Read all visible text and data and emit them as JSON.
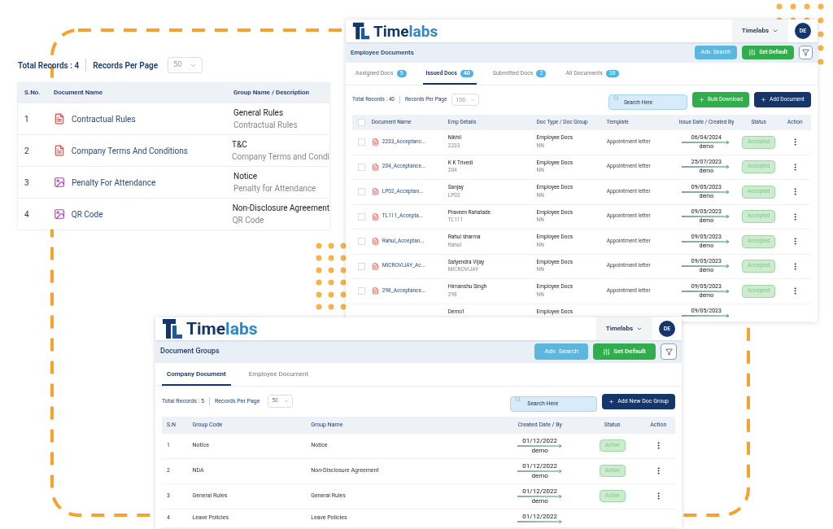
{
  "document_list": {
    "total_records": "Total Records : 4",
    "records_per_page_label": "Records Per Page",
    "records_per_page": "50",
    "columns": [
      "S.No.",
      "Document Name",
      "Group Name / Description"
    ],
    "rows": [
      {
        "sno": "1",
        "kind": "pdf",
        "name": "Contractual Rules",
        "group": "General Rules",
        "description": "Contractual Rules"
      },
      {
        "sno": "2",
        "kind": "pdf",
        "name": "Company Terms And Conditions",
        "group": "T&C",
        "description": "Company Terms and Condi"
      },
      {
        "sno": "3",
        "kind": "image",
        "name": "Penalty For Attendance",
        "group": "Notice",
        "description": "Penalty for Attendance"
      },
      {
        "sno": "4",
        "kind": "image",
        "name": "QR Code",
        "group": "Non-Disclosure Agreement",
        "description": "QR Code"
      }
    ]
  },
  "employee_documents": {
    "logo": {
      "part_1": "Time",
      "part_2": "labs"
    },
    "company": "Timelabs",
    "avatar": "DE",
    "title": "Employee Documents",
    "adv_search": "Adv. Search",
    "set_default": "Set Default",
    "tabs": [
      {
        "label": "Assigned Docs",
        "count": "5",
        "selected": false
      },
      {
        "label": "Issued Docs",
        "count": "40",
        "selected": true
      },
      {
        "label": "Submitted Docs",
        "count": "2",
        "selected": false
      },
      {
        "label": "All Documents",
        "count": "38",
        "selected": false
      }
    ],
    "total_records": "Total Records : 40",
    "records_per_page_label": "Records Per Page",
    "records_per_page": "100",
    "search_placeholder": "Search Here",
    "bulk_download": "Bulk Download",
    "add_document": "Add Document",
    "select_all_checked": false,
    "columns": [
      "Document Name",
      "Emp Details",
      "Doc Type / Doc Group",
      "Template",
      "Issue Date / Created By",
      "Status",
      "Action"
    ],
    "rows": [
      {
        "checked": false,
        "document": "2233_Acceptanc...",
        "emp_name": "Nikhil",
        "emp_code": "2233",
        "doc_type": "Employee Docs",
        "doc_group": "NN",
        "template": "Appointment letter",
        "date": "06/04/2024",
        "created_by": "demo",
        "status": "Accepted"
      },
      {
        "checked": false,
        "document": "204_Acceptance...",
        "emp_name": "K K Trivedi",
        "emp_code": "204",
        "doc_type": "Employee Docs",
        "doc_group": "NN",
        "template": "Appointment letter",
        "date": "25/07/2023",
        "created_by": "demo",
        "status": "Accepted"
      },
      {
        "checked": false,
        "document": "LP02_Acceptan...",
        "emp_name": "Sanjay",
        "emp_code": "LP02",
        "doc_type": "Employee Docs",
        "doc_group": "NN",
        "template": "Appointment letter",
        "date": "09/05/2023",
        "created_by": "demo",
        "status": "Accepted"
      },
      {
        "checked": false,
        "document": "TL111_Accepta...",
        "emp_name": "Praveen Rahatade",
        "emp_code": "TL111",
        "doc_type": "Employee Docs",
        "doc_group": "NN",
        "template": "Appointment letter",
        "date": "09/05/2023",
        "created_by": "demo",
        "status": "Accepted"
      },
      {
        "checked": false,
        "document": "Rahul_Acceptan...",
        "emp_name": "Rahul sharma",
        "emp_code": "Rahul",
        "doc_type": "Employee Docs",
        "doc_group": "NN",
        "template": "Appointment letter",
        "date": "09/05/2023",
        "created_by": "demo",
        "status": "Accepted"
      },
      {
        "checked": false,
        "document": "MICROVIJAY_Ac...",
        "emp_name": "Satyendra Vijay",
        "emp_code": "MICROVIJAY",
        "doc_type": "Employee Docs",
        "doc_group": "NN",
        "template": "Appointment letter",
        "date": "09/05/2023",
        "created_by": "demo",
        "status": "Accepted"
      },
      {
        "checked": false,
        "document": "298_Acceptance...",
        "emp_name": "Himanshu Singh",
        "emp_code": "298",
        "doc_type": "Employee Docs",
        "doc_group": "NN",
        "template": "Appointment letter",
        "date": "09/05/2023",
        "created_by": "demo",
        "status": "Accepted"
      },
      {
        "emp_name": "Demo1",
        "doc_type": "Employee Docs",
        "date": "09/05/2023"
      }
    ]
  },
  "document_groups": {
    "logo": {
      "part_1": "Time",
      "part_2": "labs"
    },
    "company": "Timelabs",
    "avatar": "DE",
    "title": "Document Groups",
    "adv_search": "Adv. Search",
    "set_default": "Set Default",
    "tabs": [
      {
        "label": "Company Document",
        "selected": true
      },
      {
        "label": "Employee Document",
        "selected": false
      }
    ],
    "total_records": "Total Records : 5",
    "records_per_page_label": "Records Per Page",
    "records_per_page": "50",
    "search_placeholder": "Search Here",
    "add_group": "Add New Doc Group",
    "columns": [
      "S.N",
      "Group Code",
      "Group Name",
      "Created Date / By",
      "Status",
      "Action"
    ],
    "rows": [
      {
        "sn": "1",
        "code": "Notice",
        "name": "Notice",
        "date": "01/12/2022",
        "created_by": "demo",
        "status": "Active"
      },
      {
        "sn": "2",
        "code": "NDA",
        "name": "Non-Disclosure Agreement",
        "date": "01/12/2022",
        "created_by": "demo",
        "status": "Active"
      },
      {
        "sn": "3",
        "code": "General Rules",
        "name": "General Rules",
        "date": "01/12/2022",
        "created_by": "demo",
        "status": "Active"
      },
      {
        "sn": "4",
        "code": "Leave Policies",
        "name": "Leave Policies",
        "date": "01/12/2022"
      }
    ]
  }
}
